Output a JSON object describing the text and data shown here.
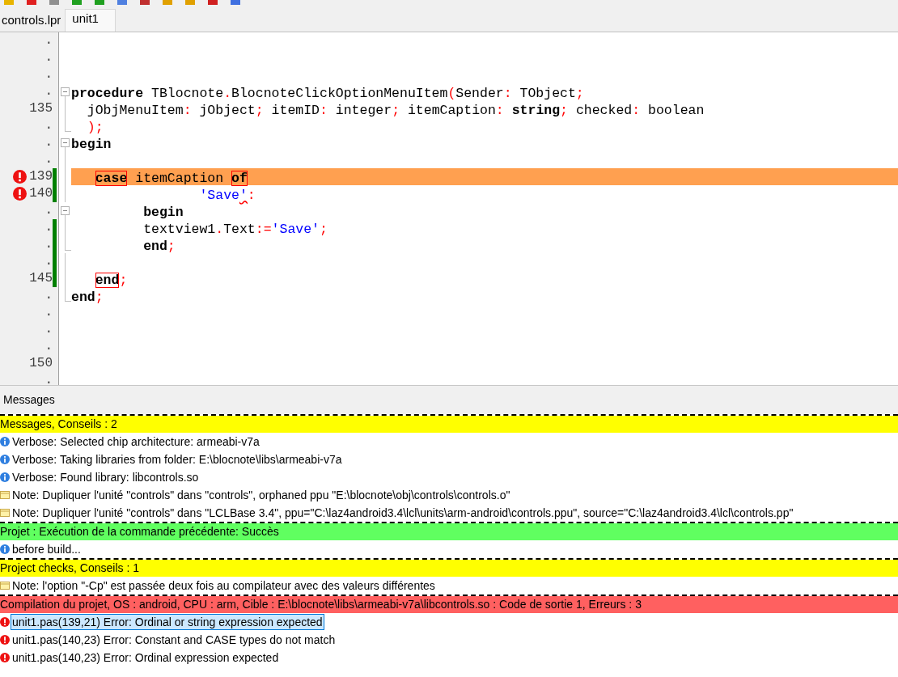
{
  "tabs": [
    {
      "label": "controls.lpr",
      "selected": false
    },
    {
      "label": "unit1",
      "selected": true
    }
  ],
  "editor": {
    "lines": [
      {
        "gutter": ".",
        "error": false,
        "modified": false,
        "highlighted": false,
        "fold_start": false,
        "fold_end": false
      },
      {
        "gutter": ".",
        "error": false,
        "modified": false,
        "highlighted": false,
        "fold_start": false,
        "fold_end": false
      },
      {
        "gutter": ".",
        "error": false,
        "modified": false,
        "highlighted": false,
        "fold_start": false,
        "fold_end": false
      },
      {
        "gutter": ".",
        "error": false,
        "modified": false,
        "highlighted": false,
        "fold_start": true,
        "fold_end": false,
        "tokens": [
          {
            "kind": "keyword",
            "text": "procedure"
          },
          {
            "kind": "ident",
            "text": " TBlocnote"
          },
          {
            "kind": "symbol",
            "text": "."
          },
          {
            "kind": "ident",
            "text": "BlocnoteClickOptionMenuItem"
          },
          {
            "kind": "symbol",
            "text": "("
          },
          {
            "kind": "ident",
            "text": "Sender"
          },
          {
            "kind": "symbol",
            "text": ":"
          },
          {
            "kind": "ident",
            "text": " TObject"
          },
          {
            "kind": "symbol",
            "text": ";"
          }
        ]
      },
      {
        "gutter": "135",
        "error": false,
        "modified": false,
        "highlighted": false,
        "fold_start": false,
        "fold_end": false,
        "tokens": [
          {
            "kind": "ident",
            "text": "  jObjMenuItem"
          },
          {
            "kind": "symbol",
            "text": ":"
          },
          {
            "kind": "ident",
            "text": " jObject"
          },
          {
            "kind": "symbol",
            "text": ";"
          },
          {
            "kind": "ident",
            "text": " itemID"
          },
          {
            "kind": "symbol",
            "text": ":"
          },
          {
            "kind": "ident",
            "text": " integer"
          },
          {
            "kind": "symbol",
            "text": ";"
          },
          {
            "kind": "ident",
            "text": " itemCaption"
          },
          {
            "kind": "symbol",
            "text": ":"
          },
          {
            "kind": "keyword",
            "text": " string"
          },
          {
            "kind": "symbol",
            "text": ";"
          },
          {
            "kind": "ident",
            "text": " checked"
          },
          {
            "kind": "symbol",
            "text": ":"
          },
          {
            "kind": "ident",
            "text": " boolean"
          }
        ]
      },
      {
        "gutter": ".",
        "error": false,
        "modified": false,
        "highlighted": false,
        "fold_start": false,
        "fold_end": true,
        "tokens": [
          {
            "kind": "symbol",
            "text": "  );"
          }
        ]
      },
      {
        "gutter": ".",
        "error": false,
        "modified": false,
        "highlighted": false,
        "fold_start": true,
        "fold_end": false,
        "tokens": [
          {
            "kind": "keyword",
            "text": "begin"
          }
        ]
      },
      {
        "gutter": ".",
        "error": false,
        "modified": false,
        "highlighted": false,
        "fold_start": false,
        "fold_end": false
      },
      {
        "gutter": "139",
        "error": true,
        "modified": true,
        "highlighted": true,
        "fold_start": false,
        "fold_end": false,
        "tokens": [
          {
            "kind": "matched",
            "text": "   case"
          },
          {
            "kind": "ident",
            "text": " itemCaption "
          },
          {
            "kind": "matched",
            "text": "of"
          }
        ]
      },
      {
        "gutter": "140",
        "error": true,
        "modified": true,
        "highlighted": false,
        "fold_start": false,
        "fold_end": false,
        "tokens": [
          {
            "kind": "string",
            "text": "                'Save"
          },
          {
            "kind": "flagged",
            "text": "'"
          },
          {
            "kind": "symbol",
            "text": ":"
          }
        ]
      },
      {
        "gutter": ".",
        "error": false,
        "modified": false,
        "highlighted": false,
        "fold_start": true,
        "fold_end": false,
        "tokens": [
          {
            "kind": "keyword",
            "text": "         begin"
          }
        ]
      },
      {
        "gutter": ".",
        "error": false,
        "modified": true,
        "highlighted": false,
        "fold_start": false,
        "fold_end": false,
        "tokens": [
          {
            "kind": "ident",
            "text": "         textview1"
          },
          {
            "kind": "symbol",
            "text": "."
          },
          {
            "kind": "ident",
            "text": "Text"
          },
          {
            "kind": "symbol",
            "text": ":="
          },
          {
            "kind": "string",
            "text": "'Save'"
          },
          {
            "kind": "symbol",
            "text": ";"
          }
        ]
      },
      {
        "gutter": ".",
        "error": false,
        "modified": true,
        "highlighted": false,
        "fold_start": false,
        "fold_end": true,
        "tokens": [
          {
            "kind": "keyword",
            "text": "         end"
          },
          {
            "kind": "symbol",
            "text": ";"
          }
        ]
      },
      {
        "gutter": ".",
        "error": false,
        "modified": true,
        "highlighted": false,
        "fold_start": false,
        "fold_end": false
      },
      {
        "gutter": "145",
        "error": false,
        "modified": true,
        "highlighted": false,
        "fold_start": false,
        "fold_end": false,
        "tokens": [
          {
            "kind": "matched",
            "text": "   end"
          },
          {
            "kind": "symbol",
            "text": ";"
          }
        ]
      },
      {
        "gutter": ".",
        "error": false,
        "modified": false,
        "highlighted": false,
        "fold_start": false,
        "fold_end": true,
        "tokens": [
          {
            "kind": "keyword",
            "text": "end"
          },
          {
            "kind": "symbol",
            "text": ";"
          }
        ]
      },
      {
        "gutter": ".",
        "error": false,
        "modified": false,
        "highlighted": false,
        "fold_start": false,
        "fold_end": false
      },
      {
        "gutter": ".",
        "error": false,
        "modified": false,
        "highlighted": false,
        "fold_start": false,
        "fold_end": false
      },
      {
        "gutter": ".",
        "error": false,
        "modified": false,
        "highlighted": false,
        "fold_start": false,
        "fold_end": false
      },
      {
        "gutter": "150",
        "error": false,
        "modified": false,
        "highlighted": false,
        "fold_start": false,
        "fold_end": false
      },
      {
        "gutter": ".",
        "error": false,
        "modified": false,
        "highlighted": false,
        "fold_start": false,
        "fold_end": false
      }
    ]
  },
  "messages": {
    "title": "Messages",
    "groups": [
      {
        "header": "Messages, Conseils : 2",
        "color": "#ffff00",
        "items": [
          {
            "kind": "info",
            "text": "Verbose: Selected chip architecture: armeabi-v7a",
            "selected": false
          },
          {
            "kind": "info",
            "text": "Verbose: Taking libraries from folder: E:\\blocnote\\libs\\armeabi-v7a",
            "selected": false
          },
          {
            "kind": "info",
            "text": "Verbose: Found library: libcontrols.so",
            "selected": false
          },
          {
            "kind": "note",
            "text": "Note: Dupliquer l'unité \"controls\" dans \"controls\", orphaned ppu \"E:\\blocnote\\obj\\controls\\controls.o\"",
            "selected": false
          },
          {
            "kind": "note",
            "text": "Note: Dupliquer l'unité \"controls\" dans \"LCLBase 3.4\", ppu=\"C:\\laz4android3.4\\lcl\\units\\arm-android\\controls.ppu\", source=\"C:\\laz4android3.4\\lcl\\controls.pp\"",
            "selected": false
          }
        ]
      },
      {
        "header": "Projet : Exécution de la commande précédente: Succès",
        "color": "#60ff60",
        "items": [
          {
            "kind": "info",
            "text": "before build...",
            "selected": false
          }
        ]
      },
      {
        "header": "Project checks, Conseils : 1",
        "color": "#ffff00",
        "items": [
          {
            "kind": "note",
            "text": "Note: l'option \"-Cp\" est passée deux fois au compilateur avec des valeurs différentes",
            "selected": false
          }
        ]
      },
      {
        "header": "Compilation du projet, OS : android, CPU : arm, Cible : E:\\blocnote\\libs\\armeabi-v7a\\libcontrols.so : Code de sortie 1, Erreurs : 3",
        "color": "#ff6060",
        "items": [
          {
            "kind": "error",
            "text": "unit1.pas(139,21) Error: Ordinal or string expression expected",
            "selected": true
          },
          {
            "kind": "error",
            "text": "unit1.pas(140,23) Error: Constant and CASE types do not match",
            "selected": false
          },
          {
            "kind": "error",
            "text": "unit1.pas(140,23) Error: Ordinal expression expected",
            "selected": false
          }
        ]
      }
    ]
  }
}
